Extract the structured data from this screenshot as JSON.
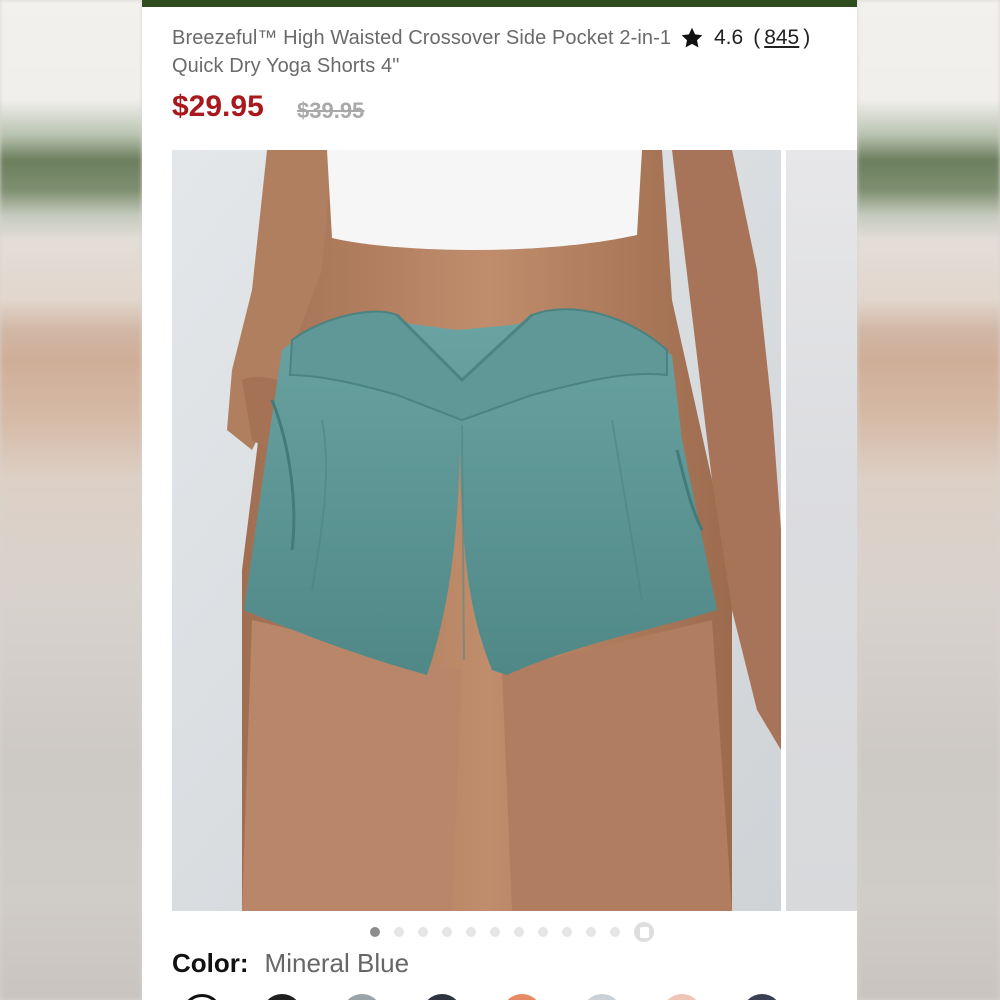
{
  "product": {
    "title": "Breezeful™ High Waisted Crossover Side Pocket 2-in-1 Quick Dry Yoga Shorts 4\"",
    "rating": "4.6",
    "review_count": "845",
    "price_current": "$29.95",
    "price_original": "$39.95"
  },
  "gallery": {
    "image_count": 12,
    "active_index": 1,
    "image_name": "teal-yoga-shorts-photo"
  },
  "color": {
    "label": "Color:",
    "selected": "Mineral Blue"
  },
  "swatches": [
    "#ffffff",
    "#1f1f1f",
    "#9aa3a8",
    "#2d3440",
    "#e58a63",
    "#c9d1d6",
    "#efc6b6",
    "#3a3f52"
  ],
  "colors": {
    "header_strip": "#2f4d1f",
    "price_red": "#a8181d",
    "shorts_teal": "#5e9b9a"
  }
}
